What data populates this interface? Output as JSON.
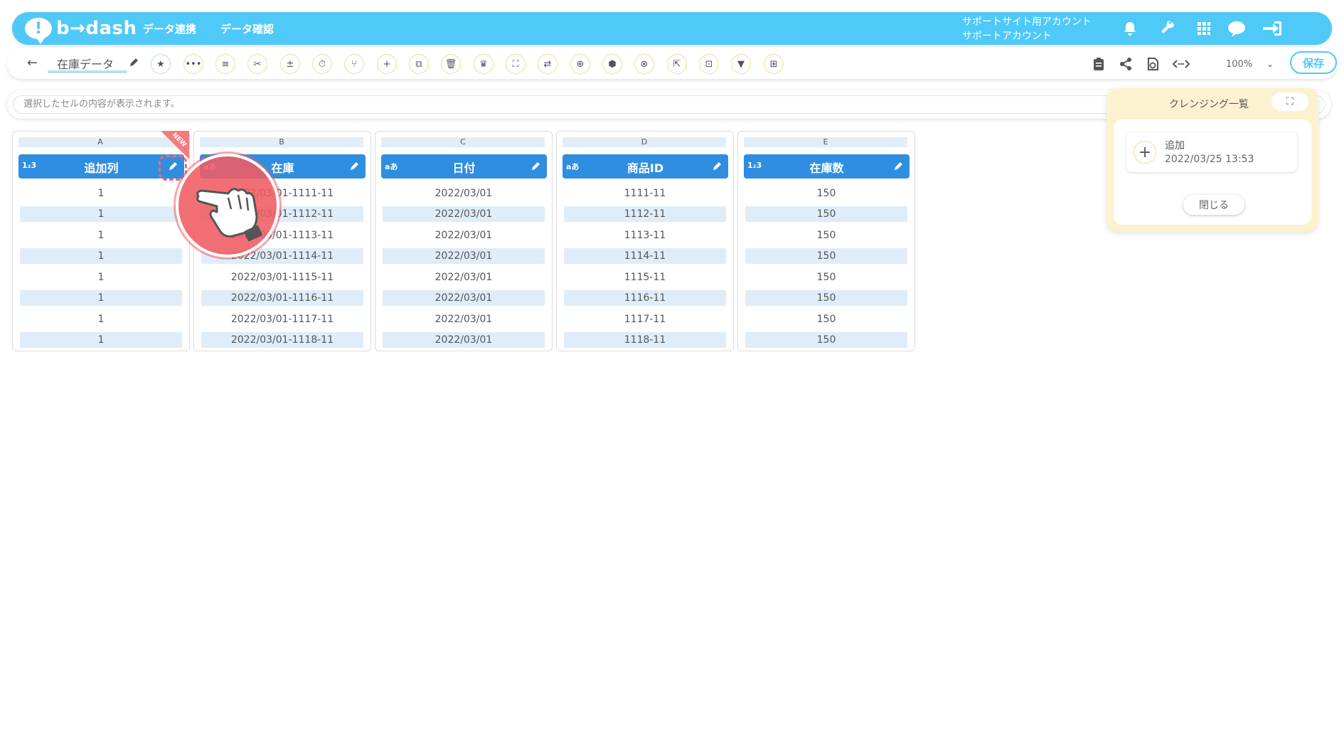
{
  "header": {
    "logo_text": "b→dash",
    "nav": [
      "データ連携",
      "データ確認"
    ],
    "account_line1": "サポートサイト用アカウント",
    "account_line2": "サポートアカウント",
    "accent_color": "#4ec9f8"
  },
  "toolbar": {
    "back_icon": "←",
    "title": "在庫データ",
    "tools": [
      "★",
      "•••",
      "≡",
      "✂",
      "±",
      "⏱",
      "⑂",
      "+",
      "⧉",
      "🗑",
      "♛",
      "⛶",
      "⇄",
      "⊕",
      "⬢",
      "⊗",
      "⇱",
      "⊡",
      "▼",
      "⊞"
    ],
    "zoom": "100%",
    "save_label": "保存"
  },
  "cellbar": {
    "placeholder": "選択したセルの内容が表示されます。"
  },
  "columns": [
    {
      "letter": "A",
      "type": "1₂3",
      "name": "追加列",
      "cells": [
        "1",
        "1",
        "1",
        "1",
        "1",
        "1",
        "1",
        "1"
      ],
      "badge": "NEW"
    },
    {
      "letter": "B",
      "type": "aあ",
      "name": "在庫",
      "cells": [
        "2022/03/01-1111-11",
        "2022/03/01-1112-11",
        "2022/03/01-1113-11",
        "2022/03/01-1114-11",
        "2022/03/01-1115-11",
        "2022/03/01-1116-11",
        "2022/03/01-1117-11",
        "2022/03/01-1118-11"
      ]
    },
    {
      "letter": "C",
      "type": "aあ",
      "name": "日付",
      "cells": [
        "2022/03/01",
        "2022/03/01",
        "2022/03/01",
        "2022/03/01",
        "2022/03/01",
        "2022/03/01",
        "2022/03/01",
        "2022/03/01"
      ]
    },
    {
      "letter": "D",
      "type": "aあ",
      "name": "商品ID",
      "cells": [
        "1111-11",
        "1112-11",
        "1113-11",
        "1114-11",
        "1115-11",
        "1116-11",
        "1117-11",
        "1118-11"
      ]
    },
    {
      "letter": "E",
      "type": "1₂3",
      "name": "在庫数",
      "cells": [
        "150",
        "150",
        "150",
        "150",
        "150",
        "150",
        "150",
        "150"
      ]
    }
  ],
  "panel": {
    "title": "クレンジング一覧",
    "item_label": "追加",
    "item_time": "2022/03/25 13:53",
    "close_label": "閉じる"
  }
}
